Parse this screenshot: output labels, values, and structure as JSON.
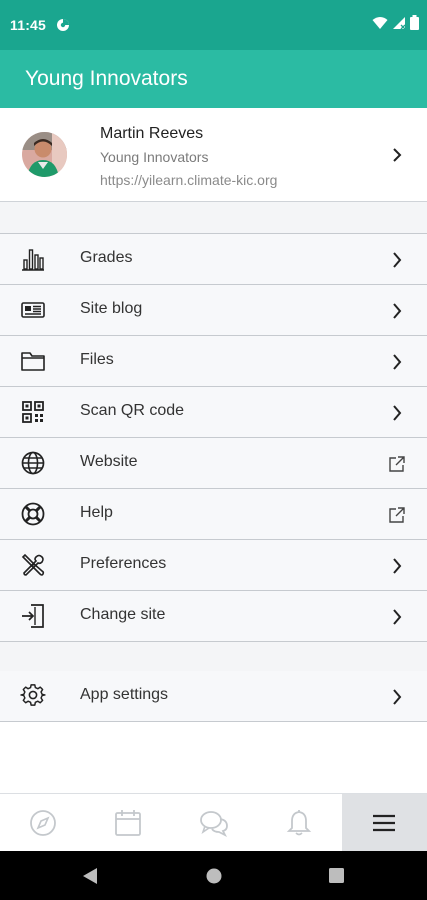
{
  "status_bar": {
    "time": "11:45"
  },
  "app_bar": {
    "title": "Young Innovators"
  },
  "profile": {
    "name": "Martin Reeves",
    "site_name": "Young Innovators",
    "site_url": "https://yilearn.climate-kic.org"
  },
  "menu": {
    "items": [
      {
        "label": "Grades",
        "icon": "bar-chart-icon",
        "trailing": "chevron-right-icon"
      },
      {
        "label": "Site blog",
        "icon": "blog-icon",
        "trailing": "chevron-right-icon"
      },
      {
        "label": "Files",
        "icon": "folder-icon",
        "trailing": "chevron-right-icon"
      },
      {
        "label": "Scan QR code",
        "icon": "qr-code-icon",
        "trailing": "chevron-right-icon"
      },
      {
        "label": "Website",
        "icon": "globe-icon",
        "trailing": "external-link-icon"
      },
      {
        "label": "Help",
        "icon": "lifebuoy-icon",
        "trailing": "external-link-icon"
      },
      {
        "label": "Preferences",
        "icon": "tools-icon",
        "trailing": "chevron-right-icon"
      },
      {
        "label": "Change site",
        "icon": "sign-in-icon",
        "trailing": "chevron-right-icon"
      }
    ]
  },
  "settings": {
    "label": "App settings",
    "icon": "gear-icon",
    "trailing": "chevron-right-icon"
  },
  "bottom_nav": {
    "tabs": [
      "compass-icon",
      "calendar-icon",
      "messages-icon",
      "bell-icon",
      "menu-icon"
    ],
    "active": "menu-icon"
  },
  "colors": {
    "status_bar": "#1aa68f",
    "app_bar": "#2bbba3",
    "background": "#f4f5f7"
  }
}
